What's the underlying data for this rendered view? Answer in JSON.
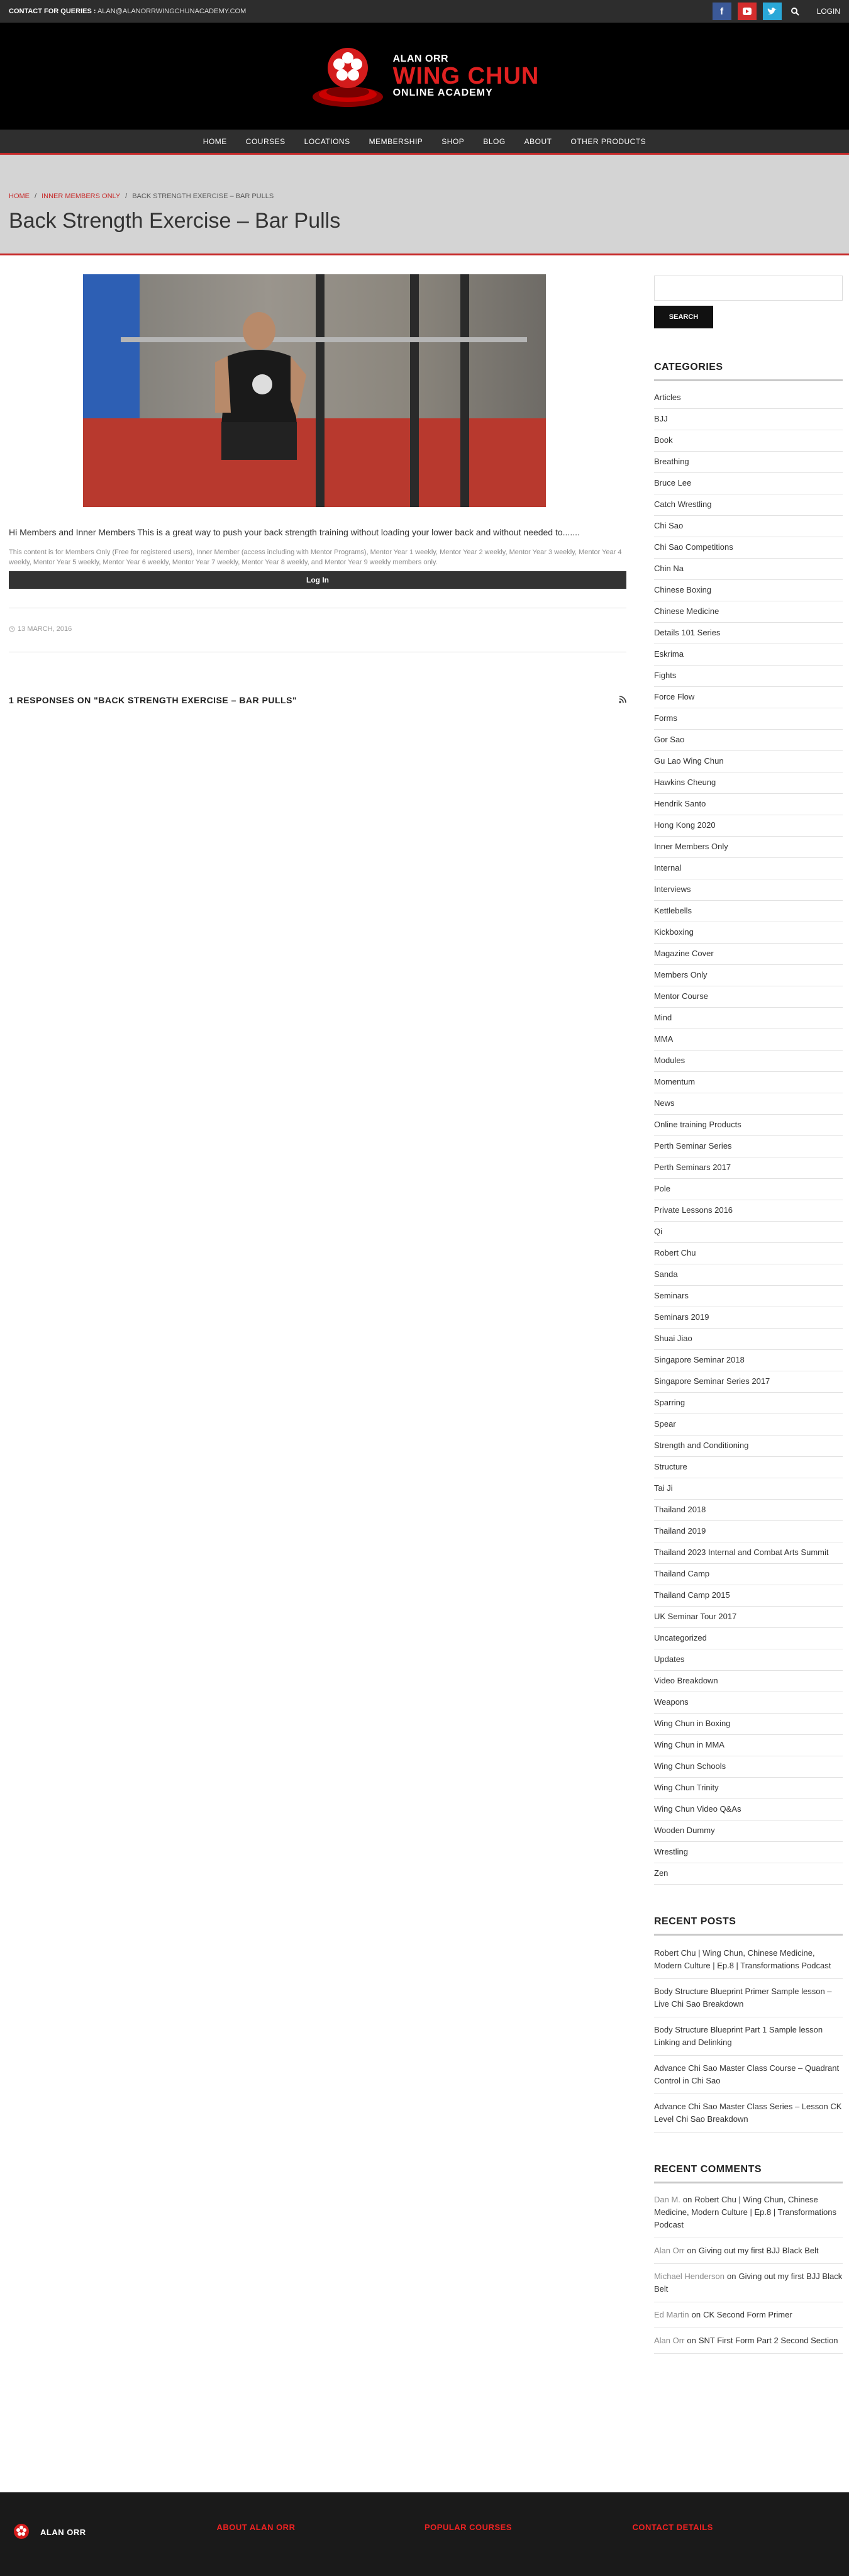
{
  "topbar": {
    "contact_label": "CONTACT FOR QUERIES :",
    "contact_email": "ALAN@ALANORRWINGCHUNACADEMY.COM",
    "login": "LOGIN",
    "colors": {
      "facebook": "#3b5998",
      "youtube": "#d42d2d",
      "twitter": "#2aa8d8"
    }
  },
  "logo": {
    "line1": "ALAN ORR",
    "line2": "WING CHUN",
    "line3": "ONLINE ACADEMY"
  },
  "nav": [
    "HOME",
    "COURSES",
    "LOCATIONS",
    "MEMBERSHIP",
    "SHOP",
    "BLOG",
    "ABOUT",
    "OTHER PRODUCTS"
  ],
  "breadcrumb": {
    "home": "HOME",
    "section": "INNER MEMBERS ONLY",
    "current": "BACK STRENGTH EXERCISE – BAR PULLS"
  },
  "page_title": "Back Strength Exercise – Bar Pulls",
  "post": {
    "intro": "Hi Members and Inner Members This is a great way to push your back strength training without loading your lower back and without needed to.......",
    "members_note": "This content is for Members Only (Free for registered users), Inner Member (access including with Mentor Programs), Mentor Year 1 weekly, Mentor Year 2 weekly, Mentor Year 3 weekly, Mentor Year 4 weekly, Mentor Year 5 weekly, Mentor Year 6 weekly, Mentor Year 7 weekly, Mentor Year 8 weekly, and Mentor Year 9 weekly members only.",
    "login_button": "Log In",
    "date": "13 MARCH, 2016",
    "responses": "1 RESPONSES ON \"BACK STRENGTH EXERCISE – BAR PULLS\""
  },
  "sidebar": {
    "search_placeholder": "",
    "search_button": "SEARCH",
    "categories_title": "CATEGORIES",
    "categories": [
      "Articles",
      "BJJ",
      "Book",
      "Breathing",
      "Bruce Lee",
      "Catch Wrestling",
      "Chi Sao",
      "Chi Sao Competitions",
      "Chin Na",
      "Chinese Boxing",
      "Chinese Medicine",
      "Details 101 Series",
      "Eskrima",
      "Fights",
      "Force Flow",
      "Forms",
      "Gor Sao",
      "Gu Lao Wing Chun",
      "Hawkins Cheung",
      "Hendrik Santo",
      "Hong Kong 2020",
      "Inner Members Only",
      "Internal",
      "Interviews",
      "Kettlebells",
      "Kickboxing",
      "Magazine Cover",
      "Members Only",
      "Mentor Course",
      "Mind",
      "MMA",
      "Modules",
      "Momentum",
      "News",
      "Online training Products",
      "Perth Seminar Series",
      "Perth Seminars 2017",
      "Pole",
      "Private Lessons 2016",
      "Qi",
      "Robert Chu",
      "Sanda",
      "Seminars",
      "Seminars 2019",
      "Shuai Jiao",
      "Singapore Seminar 2018",
      "Singapore Seminar Series 2017",
      "Sparring",
      "Spear",
      "Strength and Conditioning",
      "Structure",
      "Tai Ji",
      "Thailand 2018",
      "Thailand 2019",
      "Thailand 2023 Internal and Combat Arts Summit",
      "Thailand Camp",
      "Thailand Camp 2015",
      "UK Seminar Tour 2017",
      "Uncategorized",
      "Updates",
      "Video Breakdown",
      "Weapons",
      "Wing Chun in Boxing",
      "Wing Chun in MMA",
      "Wing Chun Schools",
      "Wing Chun Trinity",
      "Wing Chun Video Q&As",
      "Wooden Dummy",
      "Wrestling",
      "Zen"
    ],
    "recent_posts_title": "RECENT POSTS",
    "recent_posts": [
      "Robert Chu | Wing Chun, Chinese Medicine, Modern Culture | Ep.8 | Transformations Podcast",
      "Body Structure Blueprint Primer Sample lesson – Live Chi Sao Breakdown",
      "Body Structure Blueprint Part 1 Sample lesson Linking and Delinking",
      "Advance Chi Sao Master Class Course – Quadrant Control in Chi Sao",
      "Advance Chi Sao Master Class Series – Lesson CK Level Chi Sao Breakdown"
    ],
    "recent_comments_title": "RECENT COMMENTS",
    "recent_comments": [
      {
        "author": "Dan M.",
        "on": "on",
        "post": "Robert Chu | Wing Chun, Chinese Medicine, Modern Culture | Ep.8 | Transformations Podcast"
      },
      {
        "author": "Alan Orr",
        "on": "on",
        "post": "Giving out my first BJJ Black Belt"
      },
      {
        "author": "Michael Henderson",
        "on": "on",
        "post": "Giving out my first BJJ Black Belt"
      },
      {
        "author": "Ed Martin",
        "on": "on",
        "post": "CK Second Form Primer"
      },
      {
        "author": "Alan Orr",
        "on": "on",
        "post": "SNT First Form Part 2 Second Section"
      }
    ]
  },
  "footer": {
    "logo_text": "ALAN ORR",
    "col1": "ABOUT ALAN ORR",
    "col2": "POPULAR COURSES",
    "col3": "CONTACT DETAILS"
  }
}
